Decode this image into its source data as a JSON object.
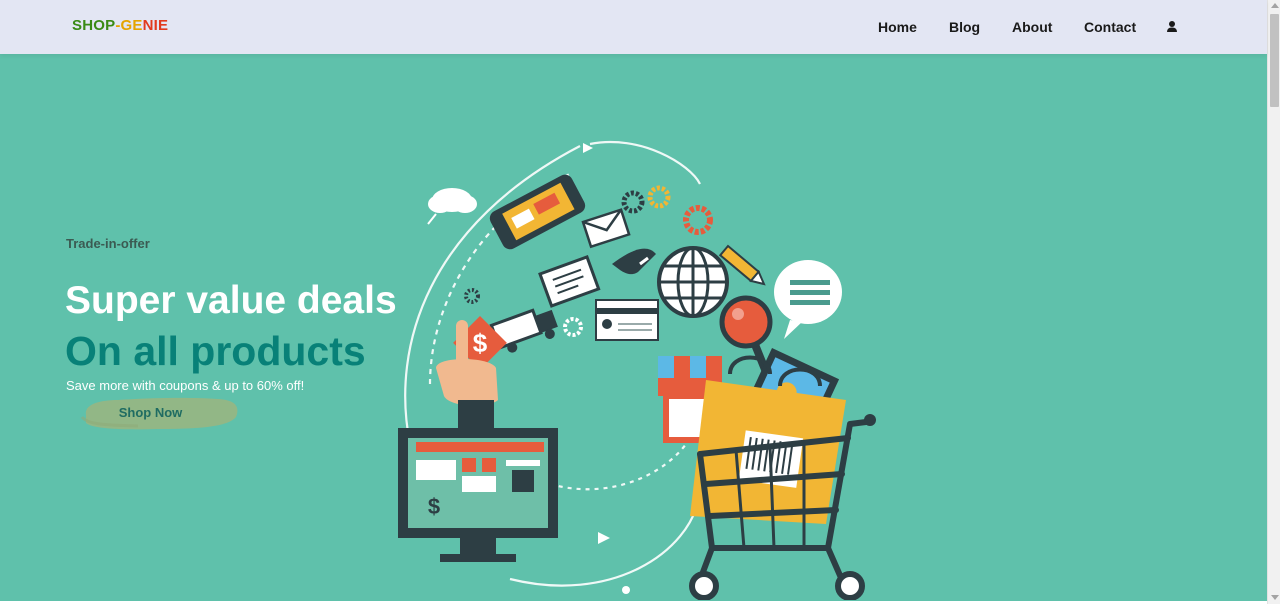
{
  "brand": {
    "part1": "SHOP",
    "part2": "-GE",
    "part3": "NIE",
    "colors": {
      "green": "#3a8a14",
      "orange": "#e5a400",
      "red": "#e23a1e"
    }
  },
  "nav": {
    "items": [
      {
        "label": "Home"
      },
      {
        "label": "Blog"
      },
      {
        "label": "About"
      },
      {
        "label": "Contact"
      }
    ],
    "user_icon": "user-icon"
  },
  "hero": {
    "offer": "Trade-in-offer",
    "title_line1": "Super value deals",
    "title_line2": "On all products",
    "subtitle": "Save more with coupons & up to 60% off!",
    "button_label": "Shop Now",
    "background_color": "#5fc1ab",
    "accent_color": "#088178",
    "illustration": "online-shopping-illustration"
  }
}
